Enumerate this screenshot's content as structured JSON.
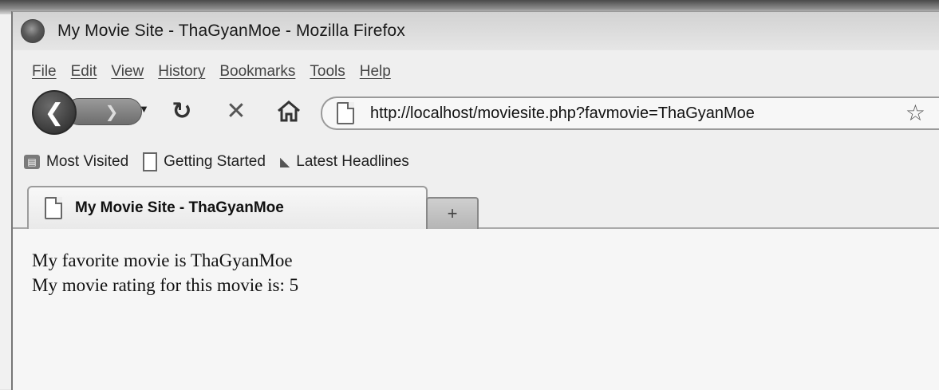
{
  "window": {
    "title": "My Movie Site - ThaGyanMoe - Mozilla Firefox"
  },
  "menubar": {
    "items": [
      "File",
      "Edit",
      "View",
      "History",
      "Bookmarks",
      "Tools",
      "Help"
    ]
  },
  "navigation": {
    "back_icon": "back-arrow-icon",
    "forward_icon": "forward-arrow-icon",
    "reload_icon": "reload-icon",
    "stop_icon": "stop-icon",
    "home_icon": "home-icon",
    "url": "http://localhost/moviesite.php?favmovie=ThaGyanMoe",
    "bookmark_star_icon": "star-icon"
  },
  "bookmarks": {
    "items": [
      {
        "label": "Most Visited",
        "icon": "most-visited-icon"
      },
      {
        "label": "Getting Started",
        "icon": "page-icon"
      },
      {
        "label": "Latest Headlines",
        "icon": "rss-icon"
      }
    ]
  },
  "tabs": [
    {
      "label": "My Movie Site - ThaGyanMoe",
      "active": true
    }
  ],
  "new_tab_label": "+",
  "content": {
    "line1": "My favorite movie is ThaGyanMoe",
    "line2": "My movie rating for this movie is: 5"
  }
}
